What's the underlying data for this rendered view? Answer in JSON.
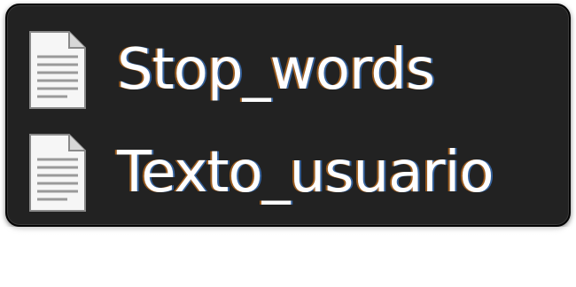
{
  "file_list": {
    "items": [
      {
        "name": "Stop_words",
        "icon": "text-document-icon"
      },
      {
        "name": "Texto_usuario",
        "icon": "text-document-icon"
      }
    ]
  },
  "colors": {
    "panel_background": "#222222",
    "label_text": "#ffffff"
  }
}
